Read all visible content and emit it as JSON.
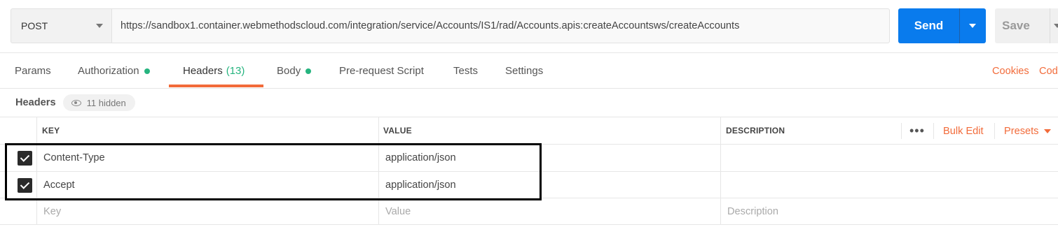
{
  "request": {
    "method": "POST",
    "url": "https://sandbox1.container.webmethodscloud.com/integration/service/Accounts/IS1/rad/Accounts.apis:createAccountsws/createAccounts",
    "send_label": "Send",
    "save_label": "Save"
  },
  "tabs": [
    {
      "label": "Params"
    },
    {
      "label": "Authorization",
      "dot": true
    },
    {
      "label": "Headers",
      "count": "(13)",
      "active": true
    },
    {
      "label": "Body",
      "dot": true
    },
    {
      "label": "Pre-request Script"
    },
    {
      "label": "Tests"
    },
    {
      "label": "Settings"
    }
  ],
  "links": {
    "cookies": "Cookies",
    "code": "Code"
  },
  "headers_section": {
    "title": "Headers",
    "hidden_label": "11 hidden"
  },
  "table": {
    "columns": {
      "key": "KEY",
      "value": "VALUE",
      "description": "DESCRIPTION"
    },
    "actions": {
      "more": "•••",
      "bulk_edit": "Bulk Edit",
      "presets": "Presets"
    },
    "rows": [
      {
        "checked": true,
        "key": "Content-Type",
        "value": "application/json",
        "description": ""
      },
      {
        "checked": true,
        "key": "Accept",
        "value": "application/json",
        "description": ""
      }
    ],
    "placeholders": {
      "key": "Key",
      "value": "Value",
      "description": "Description"
    }
  },
  "colors": {
    "accent": "#f26b3a",
    "primary": "#097bed",
    "success": "#26b47f"
  }
}
